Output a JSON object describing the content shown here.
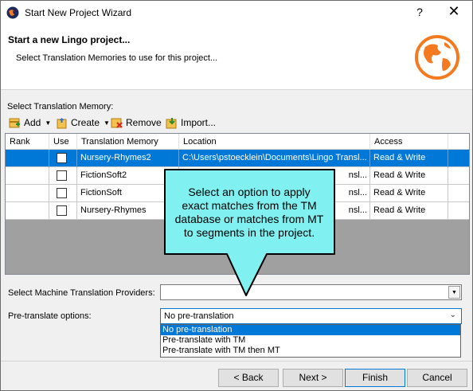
{
  "window": {
    "title": "Start New Project Wizard",
    "help_glyph": "?",
    "close_glyph": "✕"
  },
  "header": {
    "title": "Start a new Lingo project...",
    "subtitle": "Select Translation Memories to use for this project..."
  },
  "tm_section": {
    "label": "Select Translation Memory:",
    "toolbar": {
      "add_label": "Add",
      "create_label": "Create",
      "remove_label": "Remove",
      "import_label": "Import..."
    },
    "columns": [
      "Rank",
      "Use",
      "Translation Memory",
      "Location",
      "Access"
    ],
    "rows": [
      {
        "rank": "",
        "use": false,
        "name": "Nursery-Rhymes2",
        "location": "C:\\Users\\pstoecklein\\Documents\\Lingo Transl...",
        "access": "Read & Write",
        "selected": true
      },
      {
        "rank": "",
        "use": false,
        "name": "FictionSoft2",
        "location": "",
        "access": "Read & Write",
        "selected": false
      },
      {
        "rank": "",
        "use": false,
        "name": "FictionSoft",
        "location": "",
        "access": "Read & Write",
        "selected": false
      },
      {
        "rank": "",
        "use": false,
        "name": "Nursery-Rhymes",
        "location": "",
        "access": "Read & Write",
        "selected": false
      }
    ],
    "partial_location": "nsl..."
  },
  "form": {
    "mt_label": "Select Machine Translation Providers:",
    "mt_value": "",
    "pretranslate_label": "Pre-translate options:",
    "pretranslate_value": "No pre-translation",
    "pretranslate_options": [
      "No pre-translation",
      "Pre-translate with TM",
      "Pre-translate with TM then MT"
    ]
  },
  "footer": {
    "back_label": "< Back",
    "next_label": "Next >",
    "finish_label": "Finish",
    "cancel_label": "Cancel"
  },
  "callout": {
    "line1": "Select an option to apply",
    "line2": "exact matches from the TM",
    "line3": "database or matches from MT",
    "line4": "to segments in the project."
  },
  "colors": {
    "selection": "#0078d7",
    "callout_fill": "#80f0f0",
    "globe_orange": "#f47a20"
  }
}
